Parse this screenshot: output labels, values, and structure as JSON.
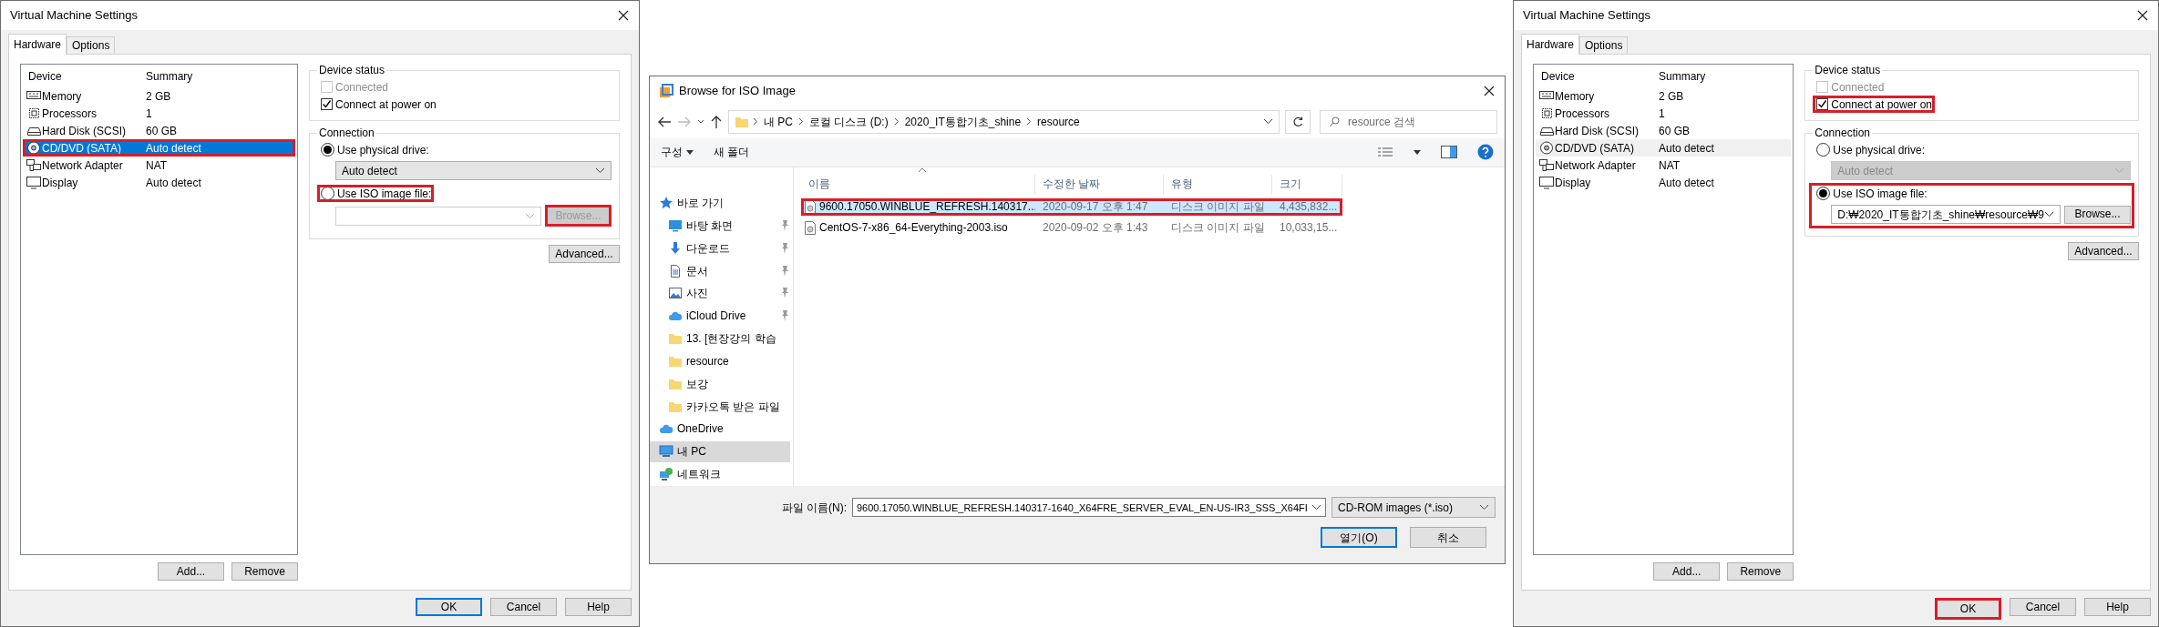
{
  "dialogs": [
    {
      "title": "Virtual Machine Settings",
      "tabs": [
        {
          "label": "Hardware",
          "selected": true
        },
        {
          "label": "Options",
          "selected": false
        }
      ],
      "device_columns": [
        "Device",
        "Summary"
      ],
      "list_focused": true,
      "devices": [
        {
          "name": "Memory",
          "summary": "2 GB",
          "selected": false,
          "highlighted": false
        },
        {
          "name": "Processors",
          "summary": "1",
          "selected": false,
          "highlighted": false
        },
        {
          "name": "Hard Disk (SCSI)",
          "summary": "60 GB",
          "selected": false,
          "highlighted": false
        },
        {
          "name": "CD/DVD (SATA)",
          "summary": "Auto detect",
          "selected": true,
          "highlighted": true
        },
        {
          "name": "Network Adapter",
          "summary": "NAT",
          "selected": false,
          "highlighted": false
        },
        {
          "name": "Display",
          "summary": "Auto detect",
          "selected": false,
          "highlighted": false
        }
      ],
      "device_status": {
        "title": "Device status",
        "connected": {
          "label": "Connected",
          "checked": false,
          "disabled": true,
          "highlighted": false
        },
        "connect_at_power_on": {
          "label": "Connect at power on",
          "checked": true,
          "disabled": false,
          "highlighted": false
        }
      },
      "connection": {
        "title": "Connection",
        "iso_section_highlighted": false,
        "physical": {
          "label": "Use physical drive:",
          "selected": true,
          "highlighted": false
        },
        "drive": {
          "value": "Auto detect",
          "disabled": false
        },
        "iso": {
          "label": "Use ISO image file:",
          "selected": false,
          "highlighted": true
        },
        "iso_path": {
          "disabled": true
        },
        "browse": {
          "label": "Browse...",
          "disabled": true,
          "highlighted": true
        }
      },
      "advanced": "Advanced...",
      "list_buttons": [
        "Add...",
        "Remove"
      ],
      "footer_buttons": [
        {
          "label": "OK",
          "default": true,
          "highlighted": false
        },
        {
          "label": "Cancel",
          "default": false,
          "highlighted": false
        },
        {
          "label": "Help",
          "default": false,
          "highlighted": false
        }
      ]
    },
    {
      "title": "Virtual Machine Settings",
      "tabs": [
        {
          "label": "Hardware",
          "selected": true
        },
        {
          "label": "Options",
          "selected": false
        }
      ],
      "device_columns": [
        "Device",
        "Summary"
      ],
      "list_focused": false,
      "devices": [
        {
          "name": "Memory",
          "summary": "2 GB",
          "selected": false,
          "highlighted": false
        },
        {
          "name": "Processors",
          "summary": "1",
          "selected": false,
          "highlighted": false
        },
        {
          "name": "Hard Disk (SCSI)",
          "summary": "60 GB",
          "selected": false,
          "highlighted": false
        },
        {
          "name": "CD/DVD (SATA)",
          "summary": "Auto detect",
          "selected": true,
          "highlighted": false
        },
        {
          "name": "Network Adapter",
          "summary": "NAT",
          "selected": false,
          "highlighted": false
        },
        {
          "name": "Display",
          "summary": "Auto detect",
          "selected": false,
          "highlighted": false
        }
      ],
      "device_status": {
        "title": "Device status",
        "connected": {
          "label": "Connected",
          "checked": false,
          "disabled": true,
          "highlighted": false
        },
        "connect_at_power_on": {
          "label": "Connect at power on",
          "checked": true,
          "disabled": false,
          "highlighted": true
        }
      },
      "connection": {
        "title": "Connection",
        "iso_section_highlighted": true,
        "physical": {
          "label": "Use physical drive:",
          "selected": false,
          "highlighted": false
        },
        "drive": {
          "value": "Auto detect",
          "disabled": true
        },
        "iso": {
          "label": "Use ISO image file:",
          "selected": true,
          "highlighted": false
        },
        "iso_path": {
          "value": "D:₩2020_IT통합기초_shine₩resource₩9",
          "disabled": false
        },
        "browse": {
          "label": "Browse...",
          "disabled": false,
          "highlighted": false
        }
      },
      "advanced": "Advanced...",
      "list_buttons": [
        "Add...",
        "Remove"
      ],
      "footer_buttons": [
        {
          "label": "OK",
          "default": true,
          "highlighted": true
        },
        {
          "label": "Cancel",
          "default": false,
          "highlighted": false
        },
        {
          "label": "Help",
          "default": false,
          "highlighted": false
        }
      ]
    }
  ],
  "browse_dialog": {
    "title": "Browse for ISO Image",
    "breadcrumbs": [
      "내 PC",
      "로컬 디스크 (D:)",
      "2020_IT통합기초_shine",
      "resource"
    ],
    "search": {
      "placeholder": "resource 검색"
    },
    "toolbar": [
      "구성",
      "새 폴더"
    ],
    "nav": [
      {
        "label": "바로 가기",
        "selected": false,
        "pinned": false,
        "children": [
          {
            "label": "바탕 화면",
            "selected": false,
            "pinned": true
          },
          {
            "label": "다운로드",
            "selected": false,
            "pinned": true
          },
          {
            "label": "문서",
            "selected": false,
            "pinned": true
          },
          {
            "label": "사진",
            "selected": false,
            "pinned": true
          },
          {
            "label": "iCloud Drive",
            "selected": false,
            "pinned": true
          },
          {
            "label": "13. [현장강의 학습",
            "selected": false,
            "pinned": false
          },
          {
            "label": "resource",
            "selected": false,
            "pinned": false
          },
          {
            "label": "보강",
            "selected": false,
            "pinned": false
          },
          {
            "label": "카카오톡 받은 파일",
            "selected": false,
            "pinned": false
          }
        ]
      },
      {
        "label": "OneDrive",
        "selected": false,
        "pinned": false
      },
      {
        "label": "내 PC",
        "selected": true,
        "pinned": false
      },
      {
        "label": "네트워크",
        "selected": false,
        "pinned": false
      }
    ],
    "columns": [
      "이름",
      "수정한 날짜",
      "유형",
      "크기"
    ],
    "files": [
      {
        "name": "9600.17050.WINBLUE_REFRESH.140317...",
        "date": "2020-09-17 오후 1:47",
        "type": "디스크 이미지 파일",
        "size": "4,435,832...",
        "selected": true,
        "highlighted": true
      },
      {
        "name": "CentOS-7-x86_64-Everything-2003.iso",
        "date": "2020-09-02 오후 1:43",
        "type": "디스크 이미지 파일",
        "size": "10,033,15...",
        "selected": false,
        "highlighted": false
      }
    ],
    "file_name_label": "파일 이름(N):",
    "file_name": "9600.17050.WINBLUE_REFRESH.140317-1640_X64FRE_SERVER_EVAL_EN-US-IR3_SSS_X64FI",
    "filter": "CD-ROM images (*.iso)",
    "buttons": [
      {
        "label": "열기(O)",
        "default": true
      },
      {
        "label": "취소",
        "default": false
      }
    ]
  }
}
